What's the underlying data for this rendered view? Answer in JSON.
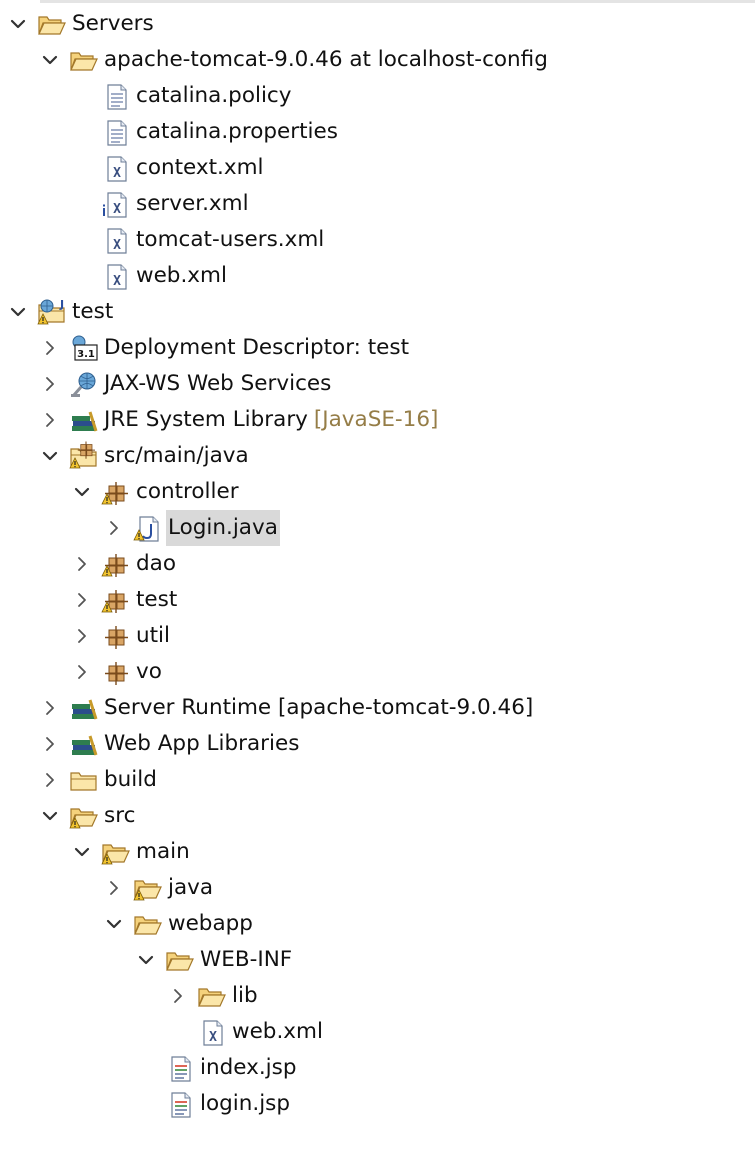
{
  "tree": [
    {
      "depth": 0,
      "chevron": "down",
      "icon": "folder-open",
      "label": "Servers"
    },
    {
      "depth": 1,
      "chevron": "down",
      "icon": "folder-open",
      "label": "apache-tomcat-9.0.46 at localhost-config"
    },
    {
      "depth": 2,
      "chevron": "none",
      "icon": "text-file",
      "label": "catalina.policy"
    },
    {
      "depth": 2,
      "chevron": "none",
      "icon": "text-file",
      "label": "catalina.properties"
    },
    {
      "depth": 2,
      "chevron": "none",
      "icon": "xml-file",
      "label": "context.xml"
    },
    {
      "depth": 2,
      "chevron": "none",
      "icon": "xml-file-info",
      "label": "server.xml"
    },
    {
      "depth": 2,
      "chevron": "none",
      "icon": "xml-file",
      "label": "tomcat-users.xml"
    },
    {
      "depth": 2,
      "chevron": "none",
      "icon": "xml-file",
      "label": "web.xml"
    },
    {
      "depth": 0,
      "chevron": "down",
      "icon": "web-project-warning",
      "label": "test"
    },
    {
      "depth": 1,
      "chevron": "right",
      "icon": "deployment-descriptor",
      "label": "Deployment Descriptor: test"
    },
    {
      "depth": 1,
      "chevron": "right",
      "icon": "web-services",
      "label": "JAX-WS Web Services"
    },
    {
      "depth": 1,
      "chevron": "right",
      "icon": "library",
      "label": "JRE System Library",
      "decoration": "[JavaSE-16]"
    },
    {
      "depth": 1,
      "chevron": "down",
      "icon": "source-folder-warning",
      "label": "src/main/java"
    },
    {
      "depth": 2,
      "chevron": "down",
      "icon": "package-warning",
      "label": "controller"
    },
    {
      "depth": 3,
      "chevron": "right",
      "icon": "java-file-warning",
      "label": "Login.java",
      "selected": true
    },
    {
      "depth": 2,
      "chevron": "right",
      "icon": "package-warning",
      "label": "dao"
    },
    {
      "depth": 2,
      "chevron": "right",
      "icon": "package-warning",
      "label": "test"
    },
    {
      "depth": 2,
      "chevron": "right",
      "icon": "package",
      "label": "util"
    },
    {
      "depth": 2,
      "chevron": "right",
      "icon": "package",
      "label": "vo"
    },
    {
      "depth": 1,
      "chevron": "right",
      "icon": "library",
      "label": "Server Runtime [apache-tomcat-9.0.46]"
    },
    {
      "depth": 1,
      "chevron": "right",
      "icon": "library",
      "label": "Web App Libraries"
    },
    {
      "depth": 1,
      "chevron": "right",
      "icon": "folder-closed",
      "label": "build"
    },
    {
      "depth": 1,
      "chevron": "down",
      "icon": "folder-open-warning",
      "label": "src"
    },
    {
      "depth": 2,
      "chevron": "down",
      "icon": "folder-open-warning",
      "label": "main"
    },
    {
      "depth": 3,
      "chevron": "right",
      "icon": "folder-open-warning",
      "label": "java"
    },
    {
      "depth": 3,
      "chevron": "down",
      "icon": "folder-open",
      "label": "webapp"
    },
    {
      "depth": 4,
      "chevron": "down",
      "icon": "folder-open",
      "label": "WEB-INF"
    },
    {
      "depth": 5,
      "chevron": "right",
      "icon": "folder-open",
      "label": "lib"
    },
    {
      "depth": 5,
      "chevron": "none",
      "icon": "xml-file",
      "label": "web.xml"
    },
    {
      "depth": 4,
      "chevron": "none",
      "icon": "jsp-file",
      "label": "index.jsp"
    },
    {
      "depth": 4,
      "chevron": "none",
      "icon": "jsp-file",
      "label": "login.jsp"
    }
  ],
  "colors": {
    "folder_fill": "#fbe6a9",
    "folder_stroke": "#a3782a",
    "warning": "#f2c430",
    "selection": "#d9d9d9",
    "decoration_text": "#957d47"
  }
}
